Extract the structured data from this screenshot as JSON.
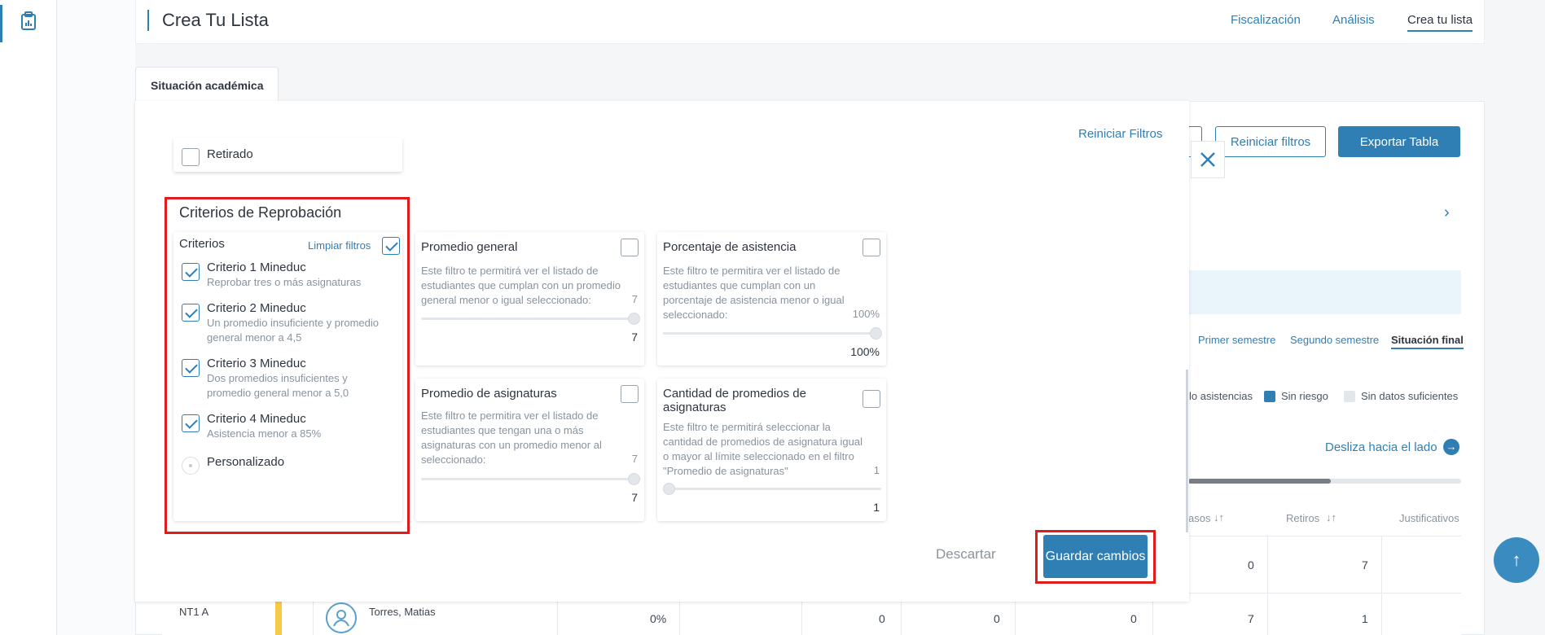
{
  "header": {
    "title": "Crea Tu Lista",
    "nav": [
      "Fiscalización",
      "Análisis",
      "Crea tu lista"
    ]
  },
  "tab": {
    "label": "Situación académica"
  },
  "background": {
    "reset_filters_button": "Reiniciar filtros",
    "export_button": "Exportar Tabla",
    "semester_tabs": [
      "Primer semestre",
      "Segundo semestre",
      "Situación final"
    ],
    "legend": [
      "lo asistencias",
      "Sin riesgo",
      "Sin datos suficientes"
    ],
    "slide_hint": "Desliza hacia el lado",
    "columns": [
      "asos",
      "Retiros",
      "Justificativos"
    ],
    "rows": [
      {
        "values": [
          "0",
          "7"
        ]
      },
      {
        "course": "NT1 A",
        "student": "Torres, Matias",
        "percent": "0%",
        "values": [
          "0",
          "0",
          "0",
          "7",
          "1"
        ]
      }
    ]
  },
  "modal": {
    "reset_link": "Reiniciar Filtros",
    "retirado_label": "Retirado",
    "section_title": "Criterios de Reprobación",
    "criteria": {
      "header": "Criterios",
      "clear_link": "Limpiar filtros",
      "items": [
        {
          "label": "Criterio 1 Mineduc",
          "desc": "Reprobar tres o más asignaturas"
        },
        {
          "label": "Criterio 2 Mineduc",
          "desc1": "Un promedio insuficiente y promedio",
          "desc2": "general menor a 4,5"
        },
        {
          "label": "Criterio 3 Mineduc",
          "desc1": "Dos promedios insuficientes y",
          "desc2": "promedio general menor a 5,0"
        },
        {
          "label": "Criterio 4 Mineduc",
          "desc": "Asistencia menor a 85%"
        }
      ],
      "custom_label": "Personalizado"
    },
    "filters": {
      "promedio_general": {
        "title": "Promedio general",
        "desc": [
          "Este filtro te permitirá ver el listado de",
          "estudiantes que cumplan con un promedio",
          "general menor o igual seleccionado:"
        ],
        "max": "7",
        "value": "7"
      },
      "asistencia": {
        "title": "Porcentaje de asistencia",
        "desc": [
          "Este filtro te permitira ver el listado de",
          "estudiantes que cumplan con un",
          "porcentaje de asistencia menor o igual",
          "seleccionado:"
        ],
        "max": "100%",
        "value": "100%"
      },
      "promedio_asignaturas": {
        "title": "Promedio de asignaturas",
        "desc": [
          "Este filtro te permitira ver el listado de",
          "estudiantes que tengan una o más",
          "asignaturas con un promedio menor al",
          "seleccionado:"
        ],
        "max": "7",
        "value": "7"
      },
      "cantidad_promedios": {
        "title1": "Cantidad de promedios de",
        "title2": "asignaturas",
        "desc": [
          "Este filtro te permitirá seleccionar la",
          "cantidad de promedios de asignatura igual",
          "o mayor al límite seleccionado en el filtro",
          "\"Promedio de asignaturas\""
        ],
        "max": "1",
        "value": "1"
      }
    },
    "discard_button": "Descartar",
    "save_button": "Guardar cambios"
  }
}
